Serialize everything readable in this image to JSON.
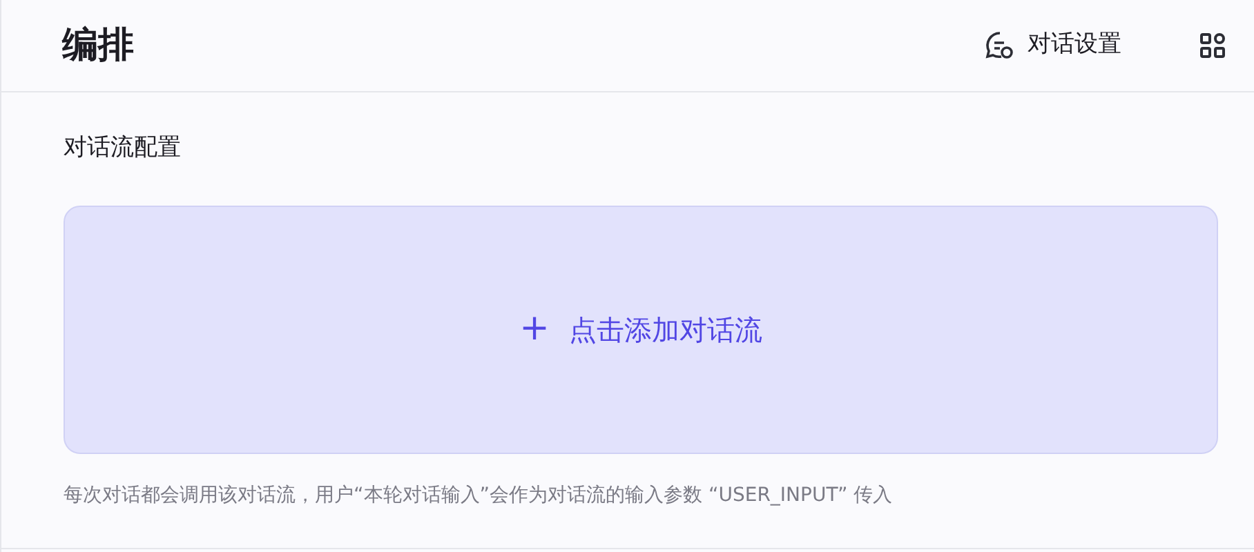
{
  "header": {
    "title": "编排",
    "actions": [
      {
        "kind": "settings",
        "label": "对话设置"
      },
      {
        "kind": "grid"
      }
    ]
  },
  "section": {
    "title": "对话流配置",
    "add_button": {
      "icon": "+",
      "label": "点击添加对话流"
    },
    "description": "每次对话都会调用该对话流，用户“本轮对话输入”会作为对话流的输入参数 “USER_INPUT” 传入"
  }
}
